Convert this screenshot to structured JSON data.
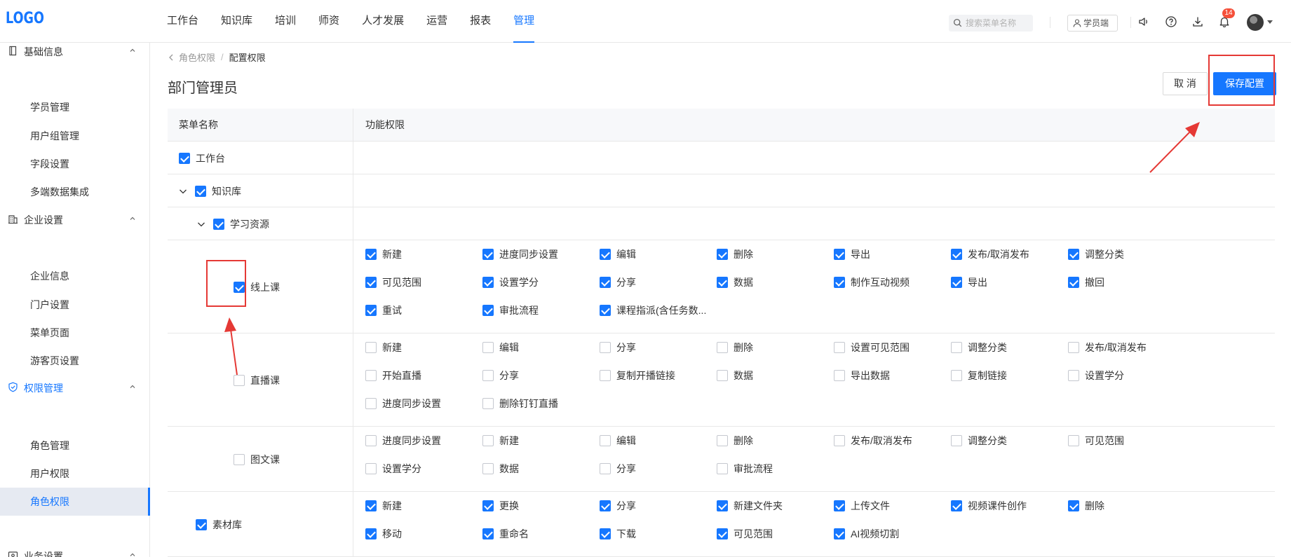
{
  "app": {
    "logo": "LOGO"
  },
  "nav": {
    "items": [
      "工作台",
      "知识库",
      "培训",
      "师资",
      "人才发展",
      "运营",
      "报表",
      "管理"
    ],
    "active": "管理",
    "search_placeholder": "搜索菜单名称",
    "student_portal": "学员端",
    "notification_count": "14"
  },
  "sidebar": {
    "groups": [
      {
        "label": "基础信息",
        "icon": "book-icon",
        "items": [
          "学员管理",
          "用户组管理",
          "字段设置",
          "多端数据集成"
        ]
      },
      {
        "label": "企业设置",
        "icon": "building-icon",
        "items": [
          "企业信息",
          "门户设置",
          "菜单页面",
          "游客页设置"
        ]
      },
      {
        "label": "权限管理",
        "icon": "shield-icon",
        "active": true,
        "items": [
          "角色管理",
          "用户权限",
          "角色权限"
        ],
        "active_item": "角色权限"
      },
      {
        "label": "业务设置",
        "icon": "settings-icon",
        "items": []
      }
    ]
  },
  "breadcrumb": {
    "parent": "角色权限",
    "separator": "/",
    "current": "配置权限"
  },
  "page": {
    "title": "部门管理员",
    "cancel_label": "取 消",
    "save_label": "保存配置"
  },
  "table": {
    "headers": {
      "menu": "菜单名称",
      "functions": "功能权限"
    },
    "rows": [
      {
        "menu": "工作台",
        "checked": true,
        "perms": []
      },
      {
        "menu": "知识库",
        "checked": true,
        "expandable": true,
        "perms": []
      },
      {
        "menu": "学习资源",
        "checked": true,
        "expandable": true,
        "perms": []
      },
      {
        "menu": "线上课",
        "checked": true,
        "perms": [
          {
            "label": "新建",
            "checked": true
          },
          {
            "label": "进度同步设置",
            "checked": true
          },
          {
            "label": "编辑",
            "checked": true
          },
          {
            "label": "删除",
            "checked": true
          },
          {
            "label": "导出",
            "checked": true
          },
          {
            "label": "发布/取消发布",
            "checked": true
          },
          {
            "label": "调整分类",
            "checked": true
          },
          {
            "label": "可见范围",
            "checked": true
          },
          {
            "label": "设置学分",
            "checked": true
          },
          {
            "label": "分享",
            "checked": true
          },
          {
            "label": "数据",
            "checked": true
          },
          {
            "label": "制作互动视频",
            "checked": true
          },
          {
            "label": "导出",
            "checked": true
          },
          {
            "label": "撤回",
            "checked": true
          },
          {
            "label": "重试",
            "checked": true
          },
          {
            "label": "审批流程",
            "checked": true
          },
          {
            "label": "课程指派(含任务数...",
            "checked": true
          }
        ]
      },
      {
        "menu": "直播课",
        "checked": false,
        "perms": [
          {
            "label": "新建",
            "checked": false
          },
          {
            "label": "编辑",
            "checked": false
          },
          {
            "label": "分享",
            "checked": false
          },
          {
            "label": "删除",
            "checked": false
          },
          {
            "label": "设置可见范围",
            "checked": false
          },
          {
            "label": "调整分类",
            "checked": false
          },
          {
            "label": "发布/取消发布",
            "checked": false
          },
          {
            "label": "开始直播",
            "checked": false
          },
          {
            "label": "分享",
            "checked": false
          },
          {
            "label": "复制开播链接",
            "checked": false
          },
          {
            "label": "数据",
            "checked": false
          },
          {
            "label": "导出数据",
            "checked": false
          },
          {
            "label": "复制链接",
            "checked": false
          },
          {
            "label": "设置学分",
            "checked": false
          },
          {
            "label": "进度同步设置",
            "checked": false
          },
          {
            "label": "删除钉钉直播",
            "checked": false
          }
        ]
      },
      {
        "menu": "图文课",
        "checked": false,
        "perms": [
          {
            "label": "进度同步设置",
            "checked": false
          },
          {
            "label": "新建",
            "checked": false
          },
          {
            "label": "编辑",
            "checked": false
          },
          {
            "label": "删除",
            "checked": false
          },
          {
            "label": "发布/取消发布",
            "checked": false
          },
          {
            "label": "调整分类",
            "checked": false
          },
          {
            "label": "可见范围",
            "checked": false
          },
          {
            "label": "设置学分",
            "checked": false
          },
          {
            "label": "数据",
            "checked": false
          },
          {
            "label": "分享",
            "checked": false
          },
          {
            "label": "审批流程",
            "checked": false
          }
        ]
      },
      {
        "menu": "素材库",
        "checked": true,
        "perms": [
          {
            "label": "新建",
            "checked": true
          },
          {
            "label": "更换",
            "checked": true
          },
          {
            "label": "分享",
            "checked": true
          },
          {
            "label": "新建文件夹",
            "checked": true
          },
          {
            "label": "上传文件",
            "checked": true
          },
          {
            "label": "视频课件创作",
            "checked": true
          },
          {
            "label": "删除",
            "checked": true
          },
          {
            "label": "移动",
            "checked": true
          },
          {
            "label": "重命名",
            "checked": true
          },
          {
            "label": "下载",
            "checked": true
          },
          {
            "label": "可见范围",
            "checked": true
          },
          {
            "label": "AI视频切割",
            "checked": true
          }
        ]
      }
    ]
  },
  "colors": {
    "primary": "#1677ff",
    "annotation": "#e53935",
    "badge": "#f5503a"
  }
}
